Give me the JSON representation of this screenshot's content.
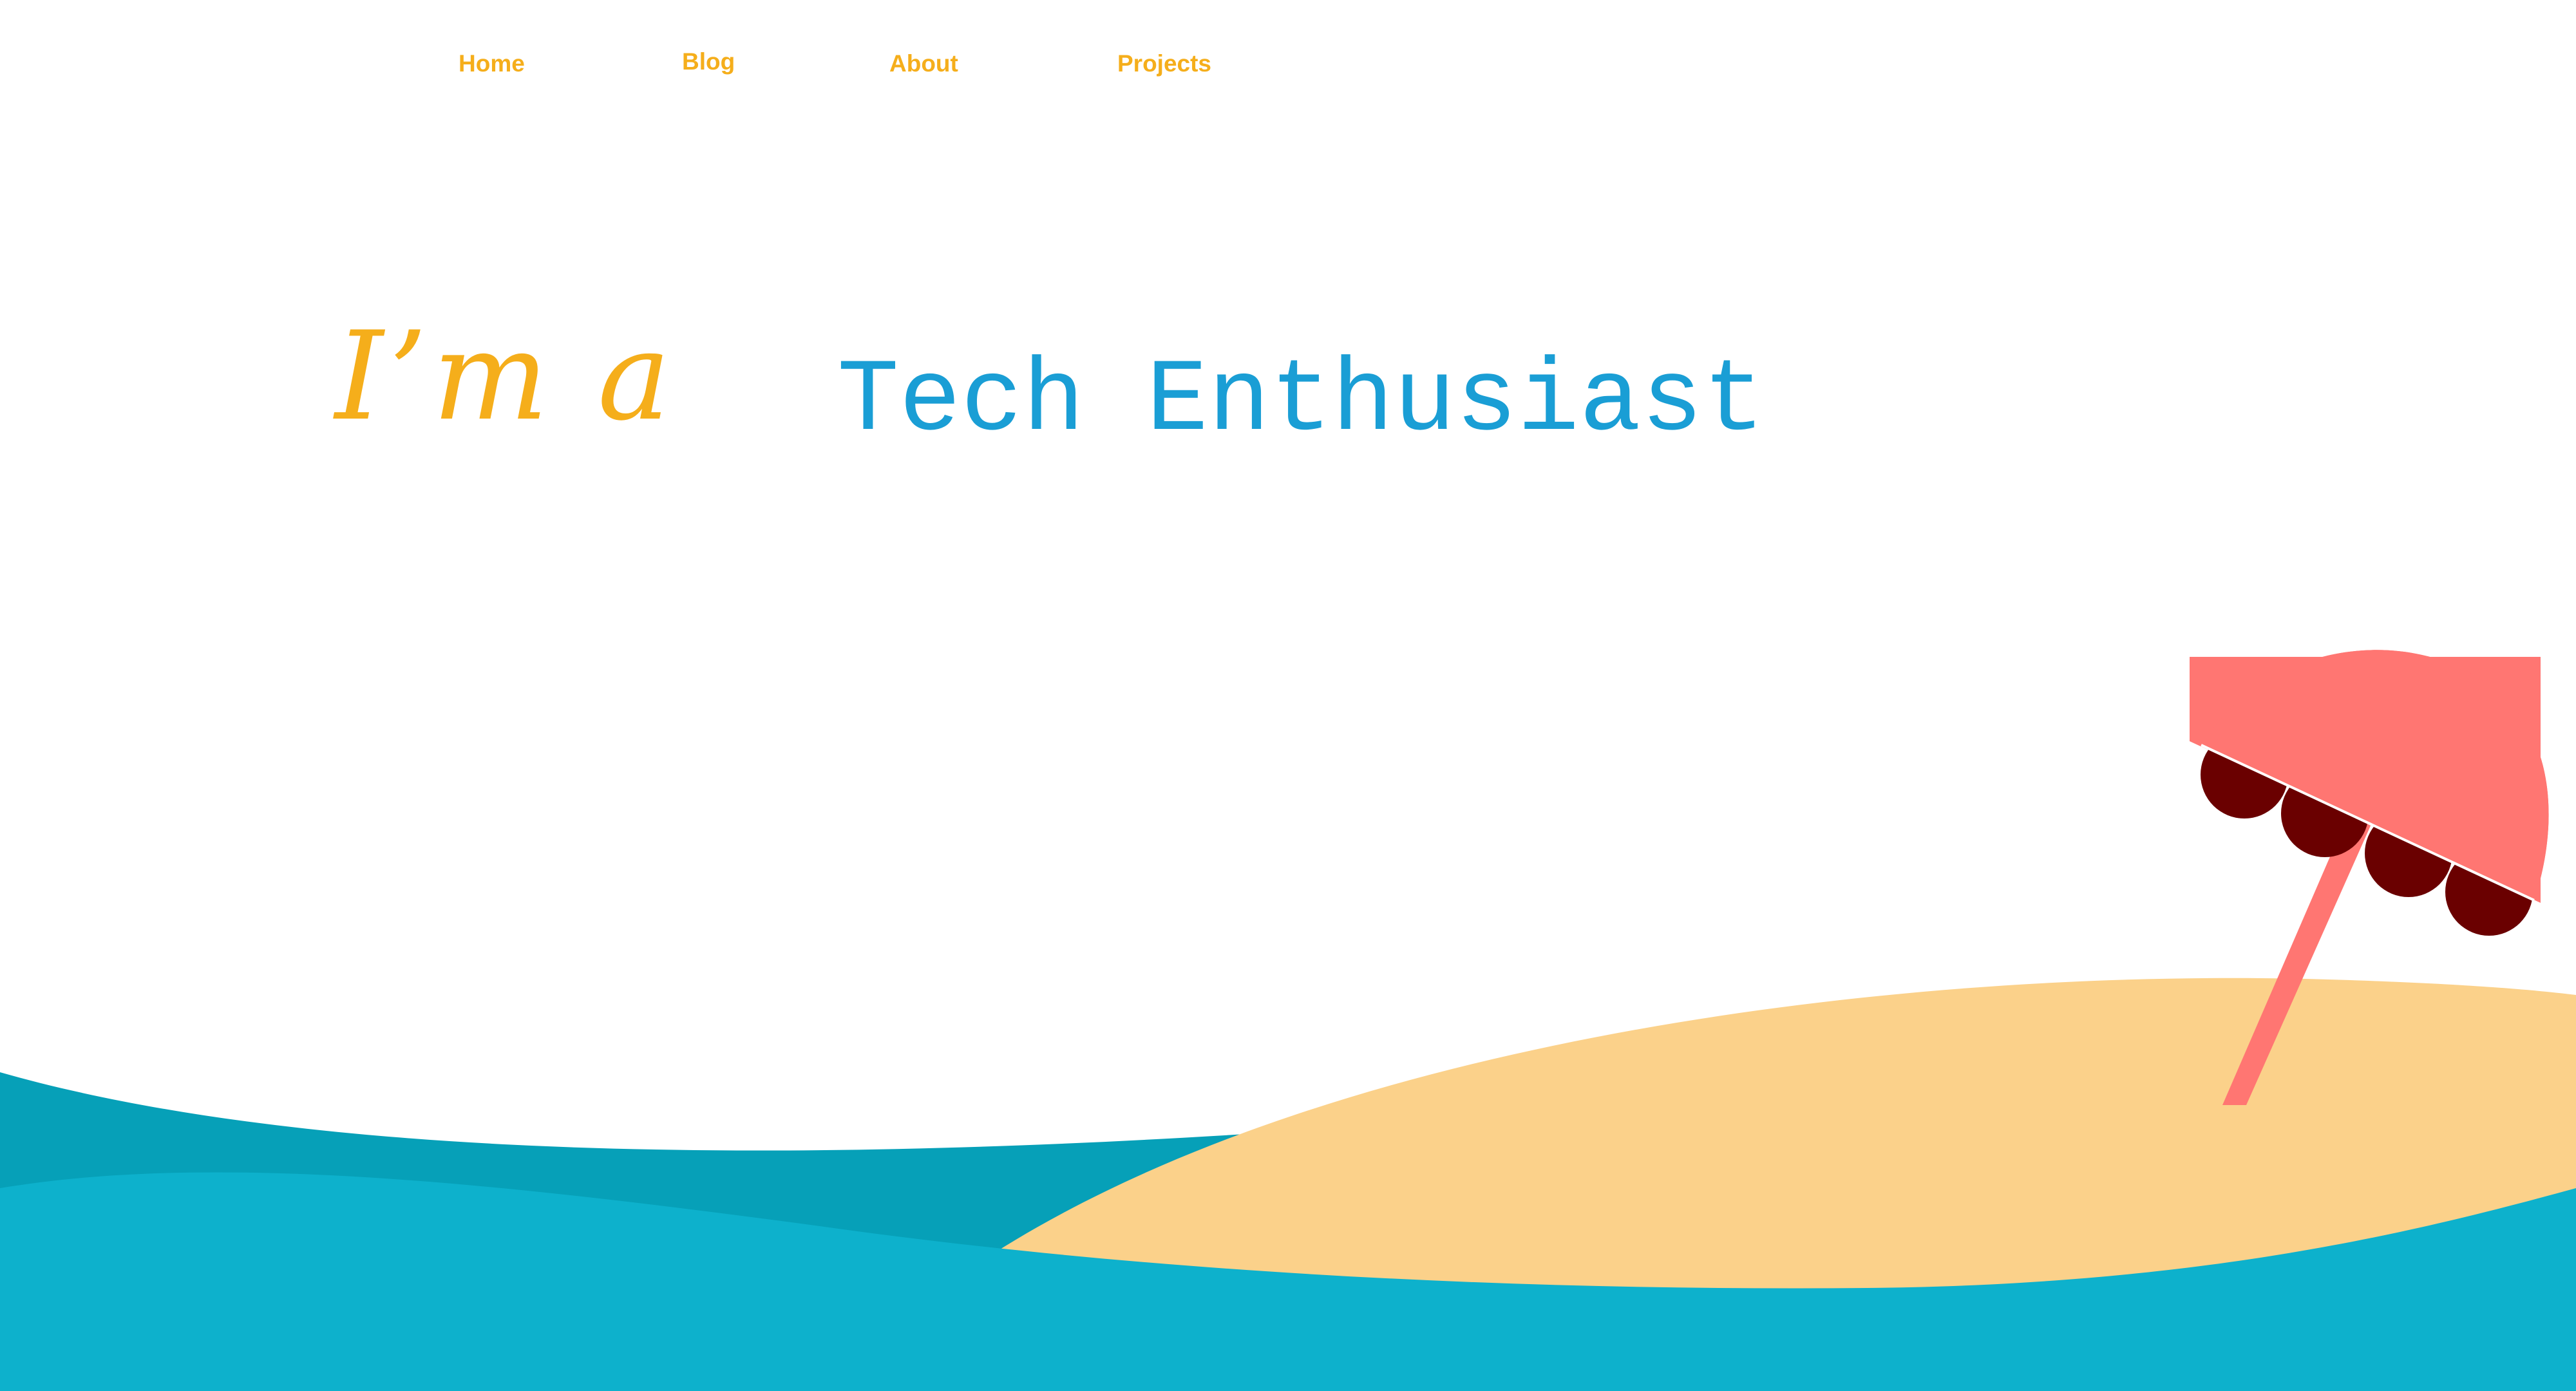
{
  "nav": {
    "home_label": "Home",
    "blog_label": "Blog",
    "about_label": "About",
    "projects_label": "Projects"
  },
  "hero": {
    "intro": "I’m a",
    "role": "Tech Enthusiast"
  },
  "colors": {
    "accent": "#f5ae1b",
    "role": "#1a9ed5",
    "sea_back": "#06a0b8",
    "sea_front": "#0db1cc",
    "sand": "#fbd18a",
    "umbrella": "#ff7672",
    "umbrella_dark": "#6a0000"
  },
  "icons": {
    "umbrella": "beach-umbrella-icon"
  }
}
